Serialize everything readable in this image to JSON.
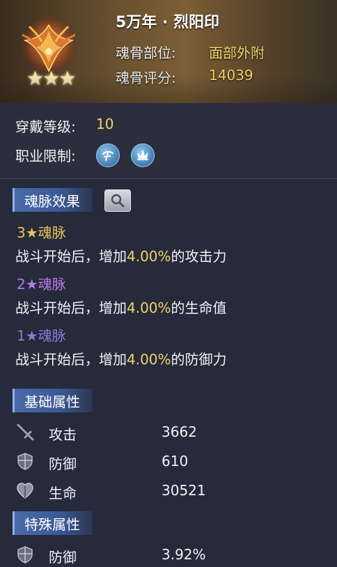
{
  "header": {
    "item_name": "5万年 · 烈阳印",
    "stars": "★★★",
    "part_label": "魂骨部位:",
    "part_value": "面部外附",
    "score_label": "魂骨评分:",
    "score_value": "14039",
    "emblem_icon": "phoenix-emblem-icon"
  },
  "requirements": {
    "level_label": "穿戴等级:",
    "level_value": "10",
    "class_label": "职业限制:",
    "class_icons": [
      "class-spirit-icon",
      "class-lotus-icon"
    ]
  },
  "veins": {
    "section_label": "魂脉效果",
    "search_icon": "magnifier-icon",
    "items": [
      {
        "star": "3",
        "star_glyph": "★",
        "name": "魂脉",
        "color": "#e8c45a",
        "desc_prefix": "战斗开始后，增加",
        "pct": "4.00%",
        "desc_suffix": "的攻击力"
      },
      {
        "star": "2",
        "star_glyph": "★",
        "name": "魂脉",
        "color": "#b77ae6",
        "desc_prefix": "战斗开始后，增加",
        "pct": "4.00%",
        "desc_suffix": "的生命值"
      },
      {
        "star": "1",
        "star_glyph": "★",
        "name": "魂脉",
        "color": "#8c7ad8",
        "desc_prefix": "战斗开始后，增加",
        "pct": "4.00%",
        "desc_suffix": "的防御力"
      }
    ]
  },
  "base_attrs": {
    "section_label": "基础属性",
    "items": [
      {
        "icon": "sword-icon",
        "name": "攻击",
        "value": "3662"
      },
      {
        "icon": "shield-icon",
        "name": "防御",
        "value": "610"
      },
      {
        "icon": "heart-icon",
        "name": "生命",
        "value": "30521"
      }
    ]
  },
  "special_attrs": {
    "section_label": "特殊属性",
    "items": [
      {
        "icon": "shield-icon",
        "name": "防御",
        "value": "3.92%"
      }
    ]
  },
  "colors": {
    "accent_gold": "#f0d56a",
    "tag_blue": "#3a5894",
    "bg": "#262a3a"
  }
}
